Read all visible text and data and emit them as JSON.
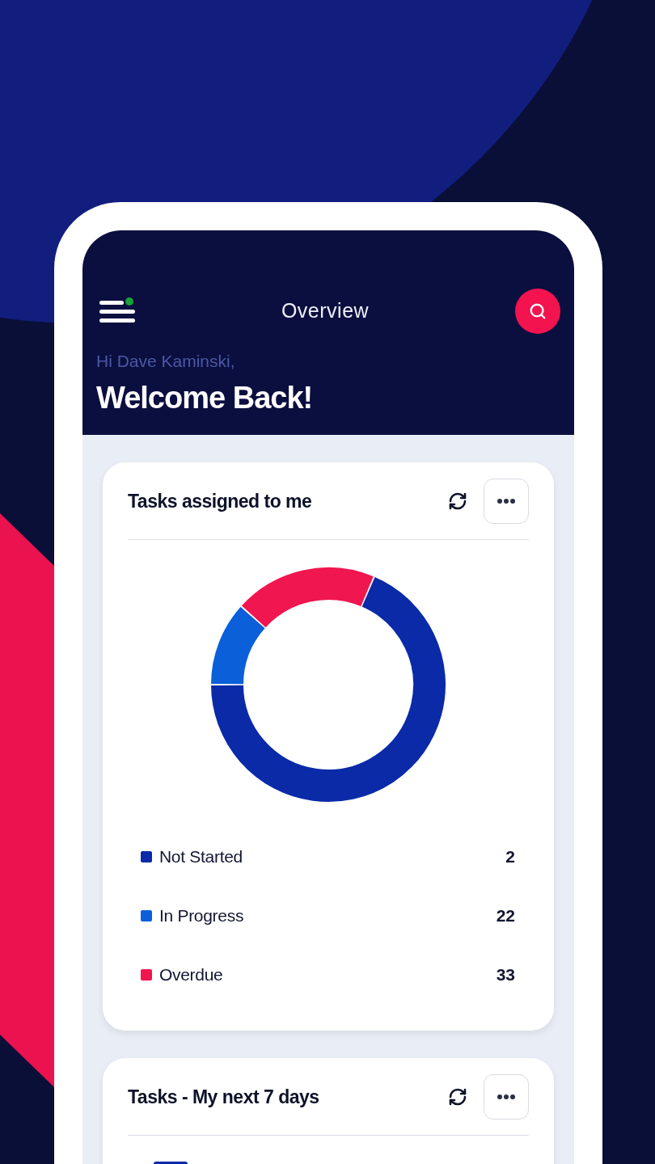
{
  "header": {
    "menu": {
      "has_notification": true
    },
    "title": "Overview",
    "greeting": "Hi Dave Kaminski,",
    "welcome": "Welcome Back!"
  },
  "cards": [
    {
      "kind": "donut",
      "title": "Tasks assigned to me",
      "legend": [
        {
          "label": "Not Started",
          "count": "2",
          "color": "#0a2aa8"
        },
        {
          "label": "In Progress",
          "count": "22",
          "color": "#0b5fd9"
        },
        {
          "label": "Overdue",
          "count": "33",
          "color": "#f0164f"
        }
      ]
    },
    {
      "kind": "bar",
      "title": "Tasks - My next 7 days"
    }
  ]
}
